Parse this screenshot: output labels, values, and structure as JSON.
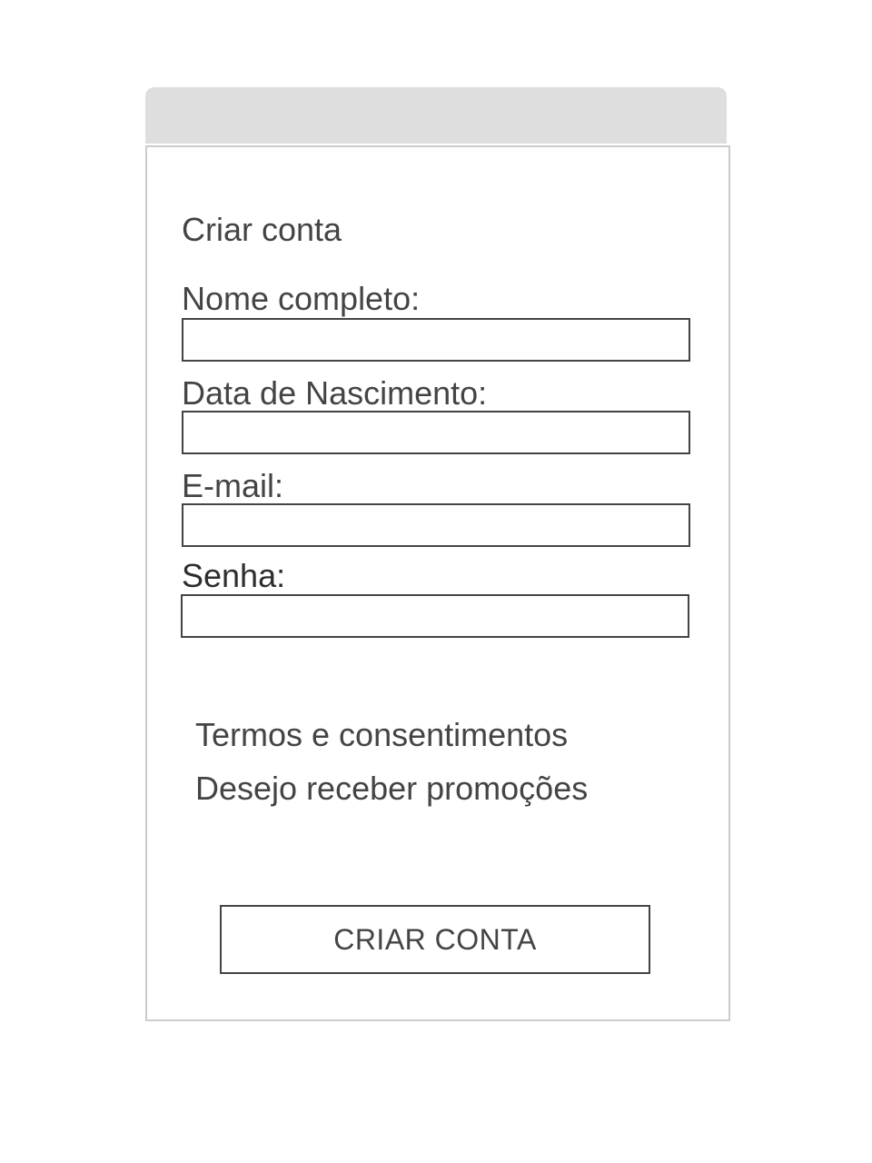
{
  "form": {
    "title": "Criar conta",
    "fields": [
      {
        "label": "Nome completo:",
        "value": "",
        "placeholder": ""
      },
      {
        "label": "Data de Nascimento:",
        "value": "",
        "placeholder": ""
      },
      {
        "label": "E-mail:",
        "value": "",
        "placeholder": ""
      },
      {
        "label": "Senha:",
        "value": "",
        "placeholder": ""
      }
    ],
    "options": [
      {
        "label": "Termos e consentimentos"
      },
      {
        "label": "Desejo receber promoções"
      }
    ],
    "submit_label": "CRIAR CONTA"
  },
  "colors": {
    "header_bar": "#dedede",
    "panel_border": "#cccccc",
    "text": "#444444",
    "input_border": "#444444"
  }
}
